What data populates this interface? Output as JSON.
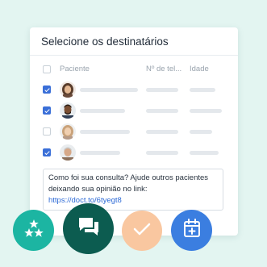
{
  "dialog": {
    "title": "Selecione os destinatários",
    "columns": {
      "patient": "Paciente",
      "phone": "Nº de tel...",
      "age": "Idade"
    },
    "rows": [
      {
        "checked": true,
        "avatar": "woman-dark-hair"
      },
      {
        "checked": true,
        "avatar": "man-beard-dark-skin"
      },
      {
        "checked": false,
        "avatar": "woman-light-hair"
      },
      {
        "checked": true,
        "avatar": "older-man"
      }
    ],
    "message": {
      "text": "Como foi sua consulta? Ajude outros pacientes deixando sua opinião no link: ",
      "link": "https://doct.to/6tyegt8"
    }
  },
  "actions": [
    {
      "icon": "rating-stars-icon",
      "color": "#1cb5a2"
    },
    {
      "icon": "chat-bubbles-icon",
      "color": "#0c5c50"
    },
    {
      "icon": "check-icon",
      "color": "#f9c7a0"
    },
    {
      "icon": "calendar-add-icon",
      "color": "#3b7ee0"
    }
  ]
}
